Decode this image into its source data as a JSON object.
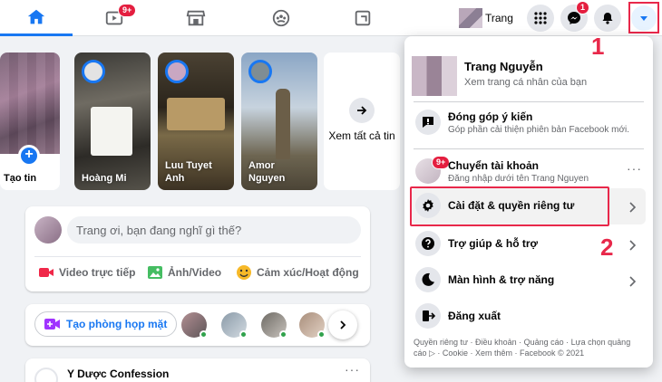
{
  "topbar": {
    "video_badge": "9+",
    "profile_name": "Trang",
    "messenger_badge": "1"
  },
  "stories": {
    "create_label": "Tạo tin",
    "items": [
      {
        "name": "Hoàng Mi"
      },
      {
        "name": "Luu Tuyet Anh"
      },
      {
        "name": "Amor Nguyen"
      }
    ],
    "see_all_label": "Xem tất cả tin"
  },
  "composer": {
    "placeholder": "Trang ơi, bạn đang nghĩ gì thế?",
    "actions": [
      {
        "label": "Video trực tiếp",
        "color": "#f02849"
      },
      {
        "label": "Ảnh/Video",
        "color": "#45bd62"
      },
      {
        "label": "Cảm xúc/Hoạt động",
        "color": "#f7b928"
      }
    ]
  },
  "rooms": {
    "create_label": "Tạo phòng họp mặt"
  },
  "post": {
    "title": "Y Dược Confession",
    "more": "···"
  },
  "menu": {
    "profile_name": "Trang Nguyễn",
    "profile_sub": "Xem trang cá nhân của bạn",
    "feedback_label": "Đóng góp ý kiến",
    "feedback_sub": "Góp phần cải thiện phiên bản Facebook mới.",
    "switch_label": "Chuyển tài khoản",
    "switch_sub": "Đăng nhập dưới tên Trang Nguyen",
    "switch_badge": "9+",
    "switch_more": "···",
    "settings_label": "Cài đặt & quyền riêng tư",
    "help_label": "Trợ giúp & hỗ trợ",
    "display_label": "Màn hình & trợ năng",
    "logout_label": "Đăng xuất",
    "footer": "Quyền riêng tư · Điều khoản · Quảng cáo · Lựa chọn quảng cáo ▷ · Cookie · Xem thêm · Facebook © 2021"
  },
  "annotations": {
    "step1": "1",
    "step2": "2"
  },
  "colors": {
    "brand": "#1877f2",
    "highlight": "#e8284a"
  }
}
